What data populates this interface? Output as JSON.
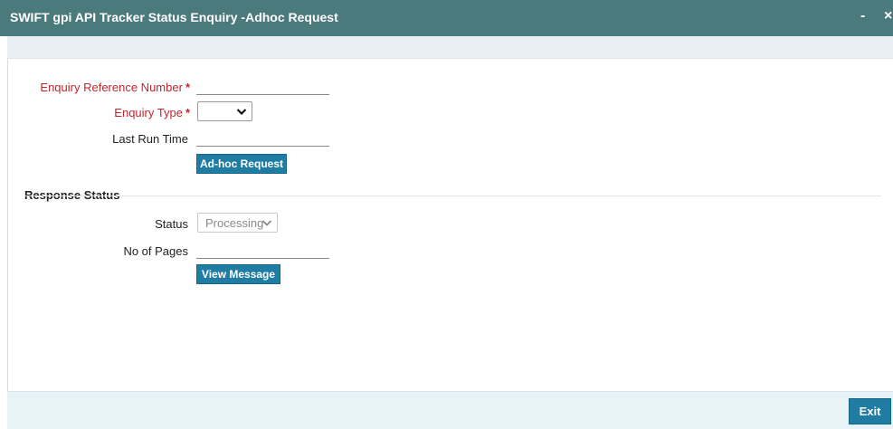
{
  "window": {
    "title": "SWIFT gpi API Tracker Status Enquiry -Adhoc Request",
    "minimize_glyph": "-",
    "close_glyph": "×"
  },
  "form": {
    "enquiry_reference": {
      "label": "Enquiry Reference Number",
      "required_mark": "*",
      "value": ""
    },
    "enquiry_type": {
      "label": "Enquiry Type",
      "required_mark": "*",
      "selected": ""
    },
    "last_run_time": {
      "label": "Last Run Time",
      "value": ""
    },
    "adhoc_button": "Ad-hoc Request"
  },
  "response": {
    "section_title": "Response Status",
    "status": {
      "label": "Status",
      "selected": "Processing"
    },
    "pages": {
      "label": "No of Pages",
      "value": ""
    },
    "view_button": "View Message"
  },
  "footer": {
    "exit_label": "Exit"
  },
  "colors": {
    "titlebar": "#4a7a7c",
    "required": "#c0262e",
    "button": "#1f7ca2",
    "footer": "#e7f3f7"
  },
  "icons": {
    "minimize": "minimize-icon",
    "close": "close-icon",
    "dropdown": "chevron-down-icon"
  }
}
